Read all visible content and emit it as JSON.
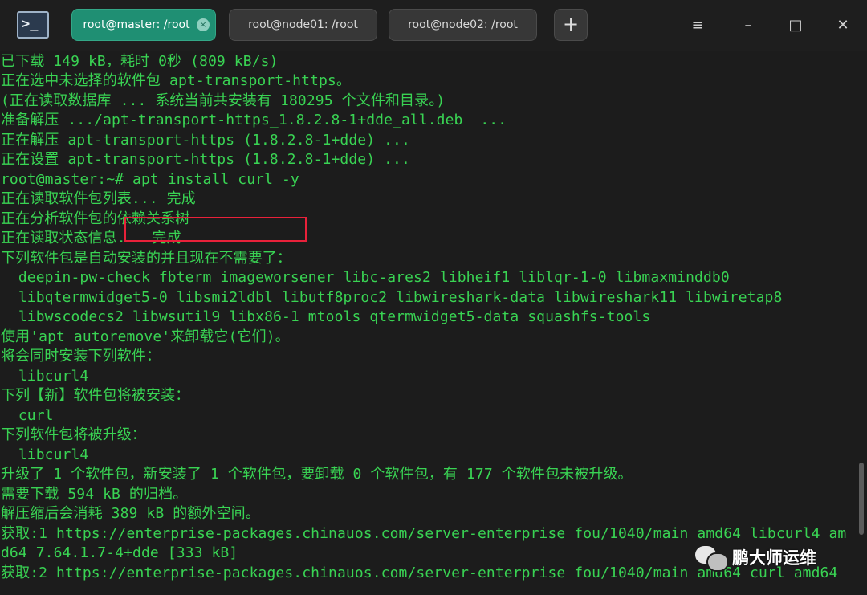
{
  "titlebar": {
    "tabs": [
      {
        "label": "root@master: /root",
        "active": true
      },
      {
        "label": "root@node01: /root",
        "active": false
      },
      {
        "label": "root@node02: /root",
        "active": false
      }
    ],
    "app_icon_text": ">_",
    "add_tab_label": "+",
    "close_tab_glyph": "×",
    "window_controls": {
      "menu": "≡",
      "minimize": "–",
      "maximize": "□",
      "close": "✕"
    }
  },
  "terminal": {
    "text_color": "#39d353",
    "lines": [
      "已下载 149 kB，耗时 0秒 (809 kB/s)",
      "正在选中未选择的软件包 apt-transport-https。",
      "(正在读取数据库 ... 系统当前共安装有 180295 个文件和目录。)",
      "准备解压 .../apt-transport-https_1.8.2.8-1+dde_all.deb  ...",
      "正在解压 apt-transport-https (1.8.2.8-1+dde) ...",
      "正在设置 apt-transport-https (1.8.2.8-1+dde) ...",
      "root@master:~# apt install curl -y",
      "正在读取软件包列表... 完成",
      "正在分析软件包的依赖关系树",
      "正在读取状态信息... 完成",
      "下列软件包是自动安装的并且现在不需要了：",
      "  deepin-pw-check fbterm imageworsener libc-ares2 libheif1 liblqr-1-0 libmaxminddb0",
      "  libqtermwidget5-0 libsmi2ldbl libutf8proc2 libwireshark-data libwireshark11 libwiretap8",
      "  libwscodecs2 libwsutil9 libx86-1 mtools qtermwidget5-data squashfs-tools",
      "使用'apt autoremove'来卸载它(它们)。",
      "将会同时安装下列软件：",
      "  libcurl4",
      "下列【新】软件包将被安装：",
      "  curl",
      "下列软件包将被升级：",
      "  libcurl4",
      "升级了 1 个软件包，新安装了 1 个软件包，要卸载 0 个软件包，有 177 个软件包未被升级。",
      "需要下载 594 kB 的归档。",
      "解压缩后会消耗 389 kB 的额外空间。",
      "获取:1 https://enterprise-packages.chinauos.com/server-enterprise fou/1040/main amd64 libcurl4 am",
      "d64 7.64.1.7-4+dde [333 kB]",
      "获取:2 https://enterprise-packages.chinauos.com/server-enterprise fou/1040/main amd64 curl amd64"
    ],
    "highlight_color": "#e8213a"
  },
  "watermark": {
    "text": "鹏大师运维"
  }
}
